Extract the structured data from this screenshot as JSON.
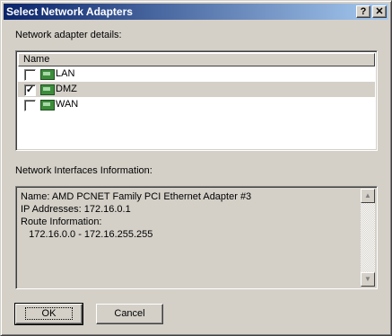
{
  "window": {
    "title": "Select Network Adapters"
  },
  "titlebar_buttons": {
    "help": "?",
    "close": "✕"
  },
  "details_label": "Network adapter details:",
  "adapter_list": {
    "column_header": "Name",
    "items": [
      {
        "label": "LAN",
        "checked": false,
        "check_mark": "",
        "selected": false
      },
      {
        "label": "DMZ",
        "checked": true,
        "check_mark": "✓",
        "selected": true
      },
      {
        "label": "WAN",
        "checked": false,
        "check_mark": "",
        "selected": false
      }
    ]
  },
  "info_label": "Network Interfaces Information:",
  "info": {
    "lines": [
      "Name: AMD PCNET Family PCI Ethernet Adapter #3",
      "IP Addresses: 172.16.0.1",
      "Route Information:",
      "   172.16.0.0 - 172.16.255.255"
    ]
  },
  "scroll": {
    "up": "▲",
    "down": "▼"
  },
  "buttons": {
    "ok": "OK",
    "cancel": "Cancel"
  }
}
